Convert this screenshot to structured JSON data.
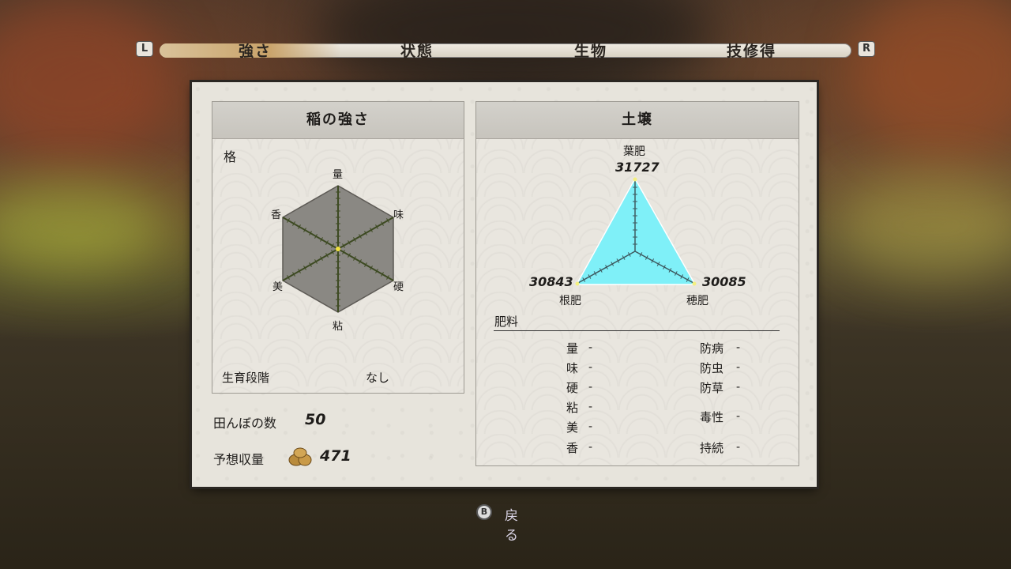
{
  "tabs": {
    "left_shoulder": "L",
    "right_shoulder": "R",
    "items": [
      {
        "label": "強さ",
        "active": true
      },
      {
        "label": "状態",
        "active": false
      },
      {
        "label": "生物",
        "active": false
      },
      {
        "label": "技修得",
        "active": false
      }
    ]
  },
  "rice_strength": {
    "title": "稲の強さ",
    "rank_label": "格",
    "axes": [
      "量",
      "味",
      "硬",
      "粘",
      "美",
      "香"
    ],
    "growth_stage_label": "生育段階",
    "growth_stage_value": "なし"
  },
  "fields": {
    "count_label": "田んぼの数",
    "count_value": "50",
    "yield_label": "予想収量",
    "yield_value": "471"
  },
  "soil": {
    "title": "土壌",
    "leaf_label": "葉肥",
    "leaf_value": "31727",
    "root_label": "根肥",
    "root_value": "30843",
    "ear_label": "穂肥",
    "ear_value": "30085",
    "fill_color": "#7ff0f8"
  },
  "fertilizer": {
    "title": "肥料",
    "left": [
      {
        "label": "量",
        "value": "-"
      },
      {
        "label": "味",
        "value": "-"
      },
      {
        "label": "硬",
        "value": "-"
      },
      {
        "label": "粘",
        "value": "-"
      },
      {
        "label": "美",
        "value": "-"
      },
      {
        "label": "香",
        "value": "-"
      }
    ],
    "right": [
      {
        "label": "防病",
        "value": "-"
      },
      {
        "label": "防虫",
        "value": "-"
      },
      {
        "label": "防草",
        "value": "-"
      },
      {
        "label": "毒性",
        "value": "-"
      },
      {
        "label": "持続",
        "value": "-"
      }
    ]
  },
  "footer": {
    "button": "B",
    "label": "戻る"
  }
}
